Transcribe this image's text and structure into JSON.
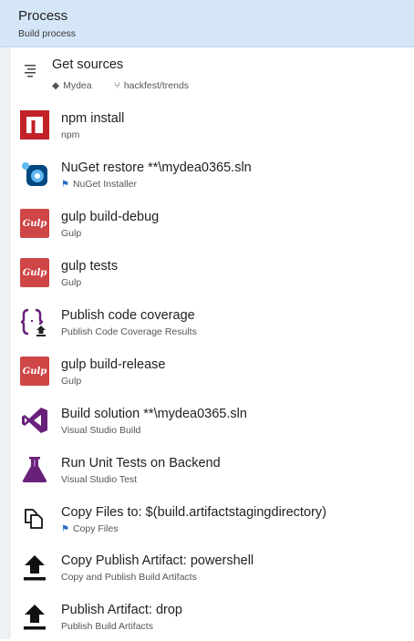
{
  "header": {
    "title": "Process",
    "subtitle": "Build process"
  },
  "source": {
    "label": "Get sources",
    "repo_icon": "git-repo-icon",
    "repo": "Mydea",
    "branch_icon": "branch-icon",
    "branch": "hackfest/trends"
  },
  "tasks": [
    {
      "name": "npm install",
      "type": "npm",
      "icon": "npm-icon"
    },
    {
      "name": "NuGet restore **\\mydea0365.sln",
      "type": "NuGet Installer",
      "icon": "nuget-icon",
      "flag": true
    },
    {
      "name": "gulp build-debug",
      "type": "Gulp",
      "icon": "gulp-icon"
    },
    {
      "name": "gulp tests",
      "type": "Gulp",
      "icon": "gulp-icon"
    },
    {
      "name": "Publish code coverage",
      "type": "Publish Code Coverage Results",
      "icon": "code-coverage-icon"
    },
    {
      "name": "gulp build-release",
      "type": "Gulp",
      "icon": "gulp-icon"
    },
    {
      "name": "Build solution **\\mydea0365.sln",
      "type": "Visual Studio Build",
      "icon": "visual-studio-icon"
    },
    {
      "name": "Run Unit Tests on Backend",
      "type": "Visual Studio Test",
      "icon": "flask-icon"
    },
    {
      "name": "Copy Files to: $(build.artifactstagingdirectory)",
      "type": "Copy Files",
      "icon": "copy-files-icon",
      "flag": true
    },
    {
      "name": "Copy Publish Artifact: powershell",
      "type": "Copy and Publish Build Artifacts",
      "icon": "upload-icon"
    },
    {
      "name": "Publish Artifact: drop",
      "type": "Publish Build Artifacts",
      "icon": "upload-icon"
    }
  ],
  "icon_text": {
    "gulp": "Gulp"
  },
  "colors": {
    "header_bg": "#d4e6f7",
    "gulp": "#cf4647",
    "npm": "#c12127",
    "vs": "#68217a",
    "nuget": "#004880",
    "flag": "#2b6cc4"
  }
}
